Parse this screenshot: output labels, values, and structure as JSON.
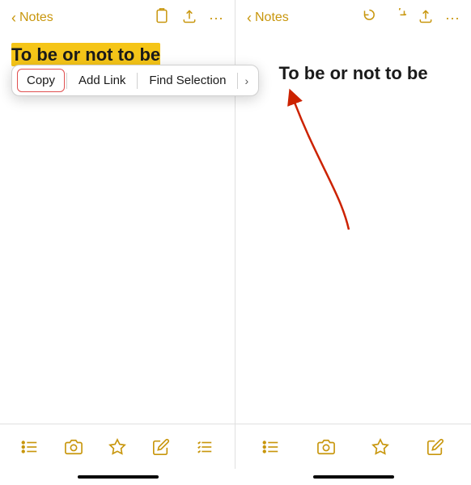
{
  "left_panel": {
    "back_label": "Notes",
    "selected_text": "To be or not to be",
    "context_menu": {
      "copy_label": "Copy",
      "add_link_label": "Add Link",
      "find_selection_label": "Find Selection",
      "more_chevron": "›"
    }
  },
  "right_panel": {
    "back_label": "Notes",
    "title_text": "To be or not to be",
    "header_icons": {
      "undo": "↺",
      "redo": "↻",
      "share": "⬆",
      "more": "···"
    }
  },
  "toolbar": {
    "left_icons": [
      "checklist",
      "camera",
      "markup",
      "compose",
      "detail"
    ],
    "right_icons": [
      "checklist",
      "camera",
      "markup",
      "compose"
    ]
  },
  "colors": {
    "accent": "#c8960c",
    "highlight": "#f5c518",
    "arrow_red": "#cc2200"
  }
}
